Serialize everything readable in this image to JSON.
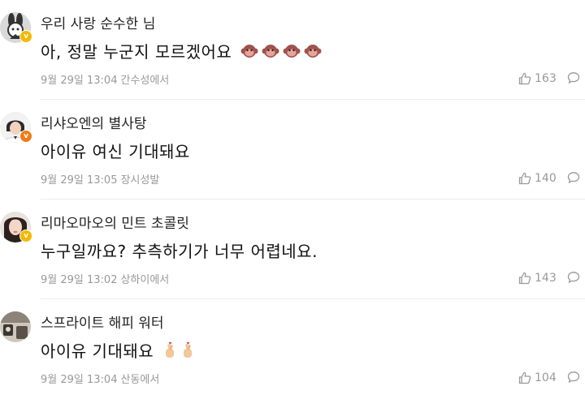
{
  "comments": [
    {
      "username": "우리 사랑 순수한 님",
      "text": "아, 정말 누군지 모르겠어요",
      "emojis": [
        "monkey-face",
        "monkey-face",
        "monkey-face",
        "monkey-face"
      ],
      "date": "9월 29일 13:04",
      "location": "간수성에서",
      "likes": "163",
      "badge_color": "#f5b800"
    },
    {
      "username": "리샤오엔의 별사탕",
      "text": "아이유 여신 기대돼요",
      "emojis": [],
      "date": "9월 29일 13:05",
      "location": "장시성발",
      "likes": "140",
      "badge_color": "#f07c1a"
    },
    {
      "username": "리마오마오의 민트 초콜릿",
      "text": "누구일까요? 추측하기가 너무 어렵네요.",
      "emojis": [],
      "date": "9월 29일 13:02",
      "location": "상하이에서",
      "likes": "143",
      "badge_color": "#f5b800"
    },
    {
      "username": "스프라이트 해피 워터",
      "text": "아이유 기대돼요",
      "emojis": [
        "finger-heart",
        "finger-heart"
      ],
      "date": "9월 29일 13:04",
      "location": "산동에서",
      "likes": "104",
      "badge_color": ""
    }
  ]
}
